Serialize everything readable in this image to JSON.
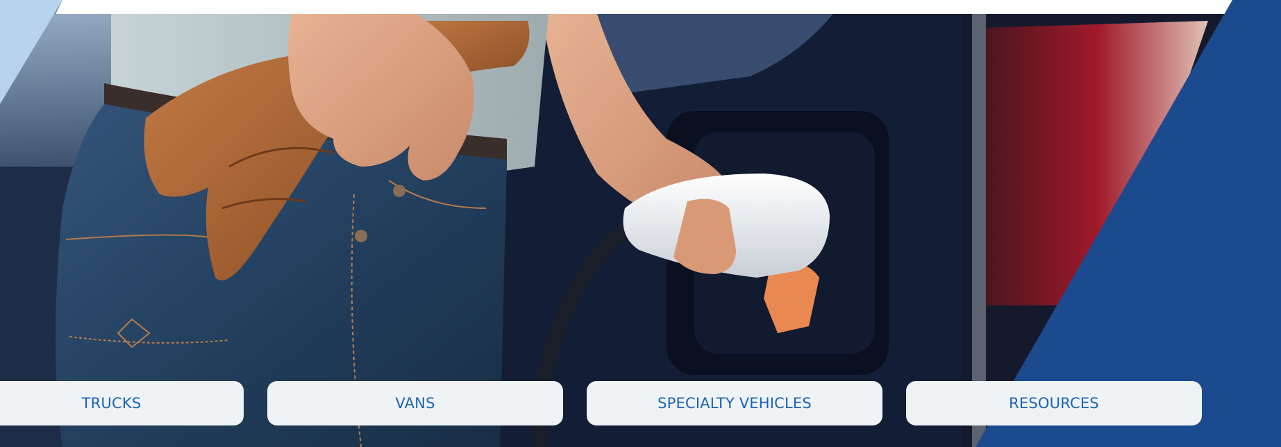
{
  "colors": {
    "accent_blue": "#1c4a8f",
    "light_blue": "#b9d3ee",
    "button_bg": "#f0f3f6",
    "button_text": "#1a63b5"
  },
  "hero": {
    "image_subject": "person holding work gloves plugging an electric charger into a vehicle"
  },
  "nav": {
    "trucks_label": "TRUCKS",
    "vans_label": "VANS",
    "specialty_label": "SPECIALTY VEHICLES",
    "resources_label": "RESOURCES"
  }
}
